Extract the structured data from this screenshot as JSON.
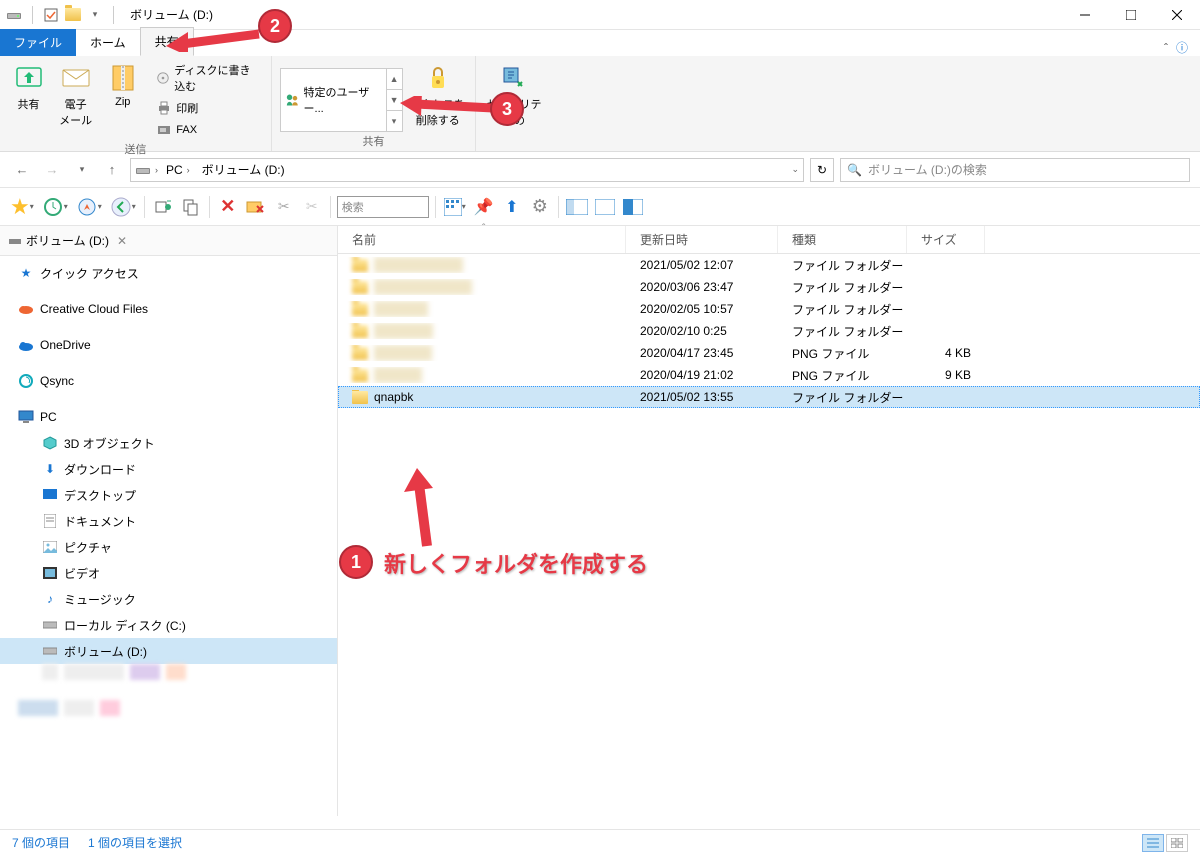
{
  "window": {
    "title": "ボリューム (D:)"
  },
  "tabs": {
    "file": "ファイル",
    "home": "ホーム",
    "share": "共有"
  },
  "ribbon": {
    "send_group": "送信",
    "share_btn": "共有",
    "mail_btn": "電子\nメール",
    "zip_btn": "Zip",
    "burn": "ディスクに書き込む",
    "print": "印刷",
    "fax": "FAX",
    "share_group": "共有",
    "specific_user": "特定のユーザー...",
    "remove_access": "アクセスを\n削除する",
    "security_btn": "セキュリティの"
  },
  "breadcrumb": {
    "pc": "PC",
    "vol": "ボリューム (D:)"
  },
  "search_placeholder": "ボリューム (D:)の検索",
  "toolbar_search": "検索",
  "sidebar_tab": "ボリューム (D:)",
  "tree": {
    "quick": "クイック アクセス",
    "cc": "Creative Cloud Files",
    "onedrive": "OneDrive",
    "qsync": "Qsync",
    "pc": "PC",
    "obj3d": "3D オブジェクト",
    "downloads": "ダウンロード",
    "desktop": "デスクトップ",
    "documents": "ドキュメント",
    "pictures": "ピクチャ",
    "videos": "ビデオ",
    "music": "ミュージック",
    "cdrive": "ローカル ディスク (C:)",
    "ddrive": "ボリューム (D:)"
  },
  "columns": {
    "name": "名前",
    "modified": "更新日時",
    "type": "種類",
    "size": "サイズ"
  },
  "files": [
    {
      "name": "",
      "modified": "2021/05/02 12:07",
      "type": "ファイル フォルダー",
      "size": "",
      "blur": true
    },
    {
      "name": "",
      "modified": "2020/03/06 23:47",
      "type": "ファイル フォルダー",
      "size": "",
      "blur": true
    },
    {
      "name": "",
      "modified": "2020/02/05 10:57",
      "type": "ファイル フォルダー",
      "size": "",
      "blur": true
    },
    {
      "name": "",
      "modified": "2020/02/10 0:25",
      "type": "ファイル フォルダー",
      "size": "",
      "blur": true
    },
    {
      "name": "",
      "modified": "2020/04/17 23:45",
      "type": "PNG ファイル",
      "size": "4 KB",
      "blur": true
    },
    {
      "name": "",
      "modified": "2020/04/19 21:02",
      "type": "PNG ファイル",
      "size": "9 KB",
      "blur": true
    },
    {
      "name": "qnapbk",
      "modified": "2021/05/02 13:55",
      "type": "ファイル フォルダー",
      "size": "",
      "selected": true
    }
  ],
  "status": {
    "total": "7 個の項目",
    "selected": "1 個の項目を選択"
  },
  "annotations": {
    "n1": "1",
    "n2": "2",
    "n3": "3",
    "text1": "新しくフォルダを作成する"
  }
}
